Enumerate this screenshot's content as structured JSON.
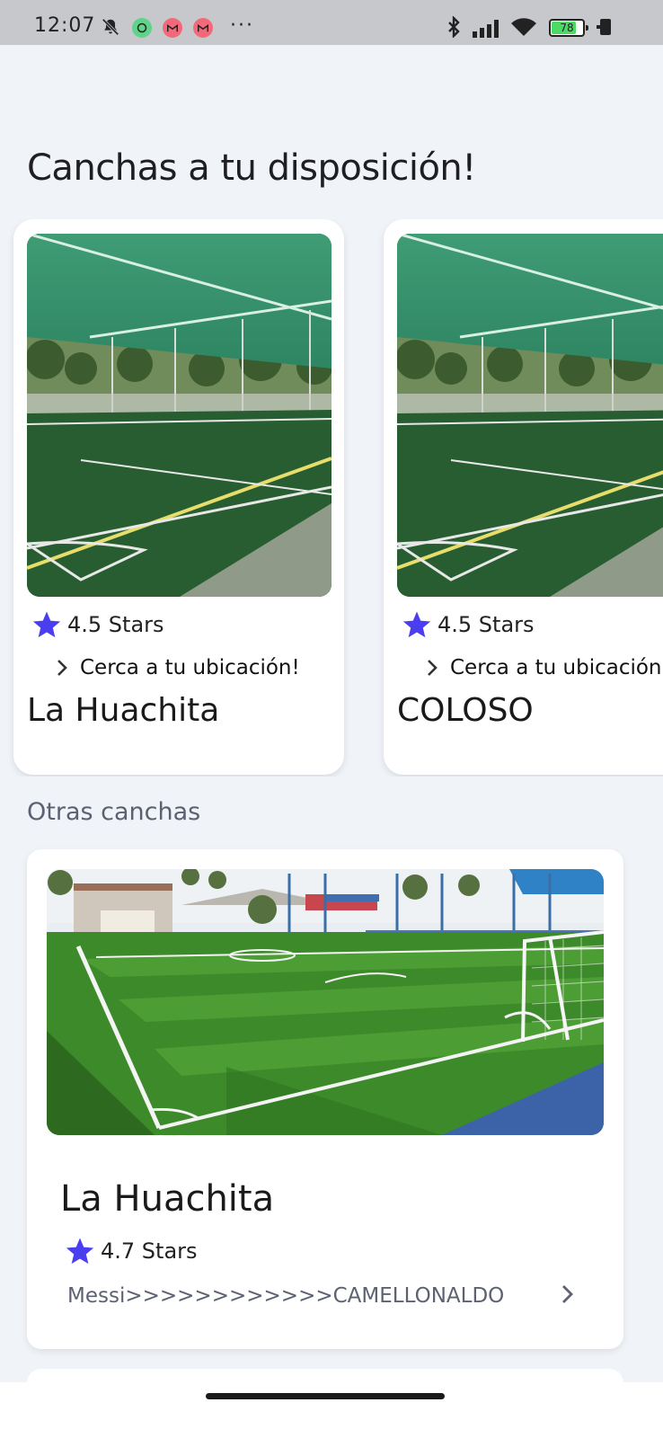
{
  "status_bar": {
    "time": "12:07",
    "battery": "78",
    "more": "···",
    "app_badges": [
      "whatsapp-icon",
      "gmail-icon",
      "gmail-icon"
    ]
  },
  "section_title": "Canchas a tu disposición!",
  "featured": [
    {
      "rating": "4.5 Stars",
      "nearby": "Cerca a tu ubicación!",
      "name": "La Huachita"
    },
    {
      "rating": "4.5 Stars",
      "nearby": "Cerca a tu ubicación!",
      "name": "COLOSO"
    }
  ],
  "other_title": "Otras canchas",
  "other": [
    {
      "name": "La Huachita",
      "rating": "4.7 Stars",
      "description": "Messi>>>>>>>>>>>>CAMELLONALDO"
    }
  ],
  "colors": {
    "background": "#f0f3f8",
    "star": "#4b3df0",
    "card": "#ffffff",
    "status_bar": "#c6c8cc"
  }
}
